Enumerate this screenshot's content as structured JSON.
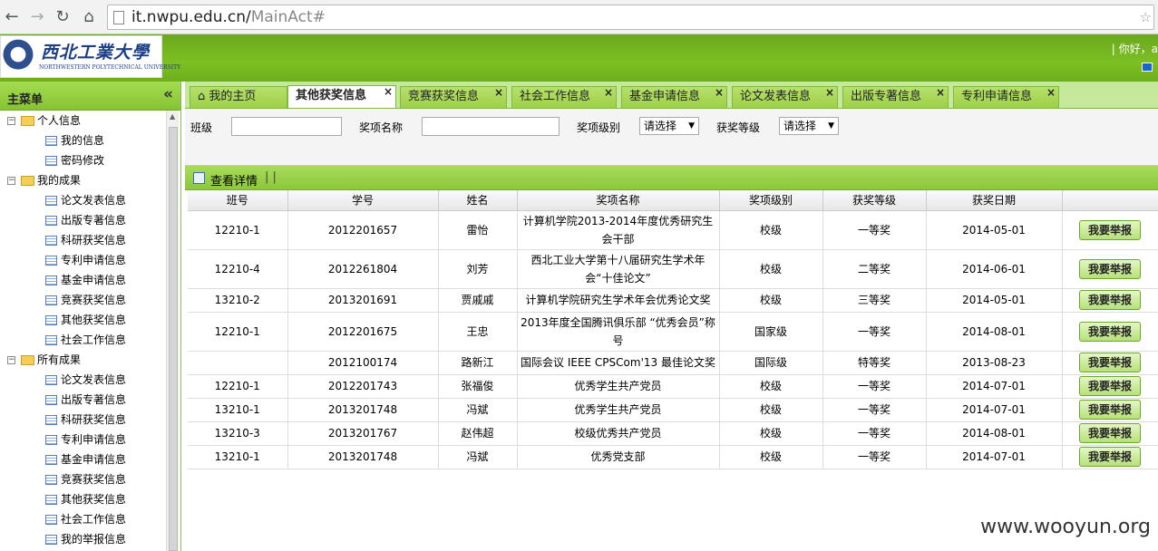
{
  "browser": {
    "url_host": "it.nwpu.edu.cn/",
    "url_path": "MainAct#"
  },
  "header": {
    "logo_cn": "西北工業大學",
    "logo_en": "NORTHWESTERN POLYTECHNICAL UNIVERSITY",
    "greeting": "| 你好，a"
  },
  "sidebar": {
    "title": "主菜单",
    "collapse": "«",
    "groups": [
      {
        "label": "个人信息",
        "items": [
          "我的信息",
          "密码修改"
        ]
      },
      {
        "label": "我的成果",
        "items": [
          "论文发表信息",
          "出版专著信息",
          "科研获奖信息",
          "专利申请信息",
          "基金申请信息",
          "竞赛获奖信息",
          "其他获奖信息",
          "社会工作信息"
        ]
      },
      {
        "label": "所有成果",
        "items": [
          "论文发表信息",
          "出版专著信息",
          "科研获奖信息",
          "专利申请信息",
          "基金申请信息",
          "竞赛获奖信息",
          "其他获奖信息",
          "社会工作信息",
          "我的举报信息"
        ]
      }
    ]
  },
  "tabs": [
    {
      "label": "我的主页",
      "closable": false
    },
    {
      "label": "其他获奖信息",
      "closable": true
    },
    {
      "label": "竞赛获奖信息",
      "closable": true
    },
    {
      "label": "社会工作信息",
      "closable": true
    },
    {
      "label": "基金申请信息",
      "closable": true
    },
    {
      "label": "论文发表信息",
      "closable": true
    },
    {
      "label": "出版专著信息",
      "closable": true
    },
    {
      "label": "专利申请信息",
      "closable": true
    }
  ],
  "search": {
    "class_label": "班级",
    "award_name_label": "奖项名称",
    "award_level_label": "奖项级别",
    "award_level_value": "请选择",
    "prize_grade_label": "获奖等级",
    "prize_grade_value": "请选择"
  },
  "toolbar": {
    "view_label": "查看详情",
    "separator": "| |"
  },
  "table": {
    "headers": [
      "班号",
      "学号",
      "姓名",
      "奖项名称",
      "奖项级别",
      "获奖等级",
      "获奖日期",
      ""
    ],
    "report_label": "我要举报",
    "rows": [
      [
        "12210-1",
        "2012201657",
        "雷怡",
        "计算机学院2013-2014年度优秀研究生会干部",
        "校级",
        "一等奖",
        "2014-05-01"
      ],
      [
        "12210-4",
        "2012261804",
        "刘芳",
        "西北工业大学第十八届研究生学术年会“十佳论文”",
        "校级",
        "二等奖",
        "2014-06-01"
      ],
      [
        "13210-2",
        "2013201691",
        "贾戚戚",
        "计算机学院研究生学术年会优秀论文奖",
        "校级",
        "三等奖",
        "2014-05-01"
      ],
      [
        "12210-1",
        "2012201675",
        "王忠",
        "2013年度全国腾讯俱乐部 “优秀会员”称号",
        "国家级",
        "一等奖",
        "2014-08-01"
      ],
      [
        "",
        "2012100174",
        "路新江",
        "国际会议 IEEE CPSCom'13 最佳论文奖",
        "国际级",
        "特等奖",
        "2013-08-23"
      ],
      [
        "12210-1",
        "2012201743",
        "张福俊",
        "优秀学生共产党员",
        "校级",
        "一等奖",
        "2014-07-01"
      ],
      [
        "13210-1",
        "2013201748",
        "冯斌",
        "优秀学生共产党员",
        "校级",
        "一等奖",
        "2014-07-01"
      ],
      [
        "13210-3",
        "2013201767",
        "赵伟超",
        "校级优秀共产党员",
        "校级",
        "一等奖",
        "2014-08-01"
      ],
      [
        "13210-1",
        "2013201748",
        "冯斌",
        "优秀党支部",
        "校级",
        "一等奖",
        "2014-07-01"
      ]
    ]
  },
  "watermark": "www.wooyun.org"
}
